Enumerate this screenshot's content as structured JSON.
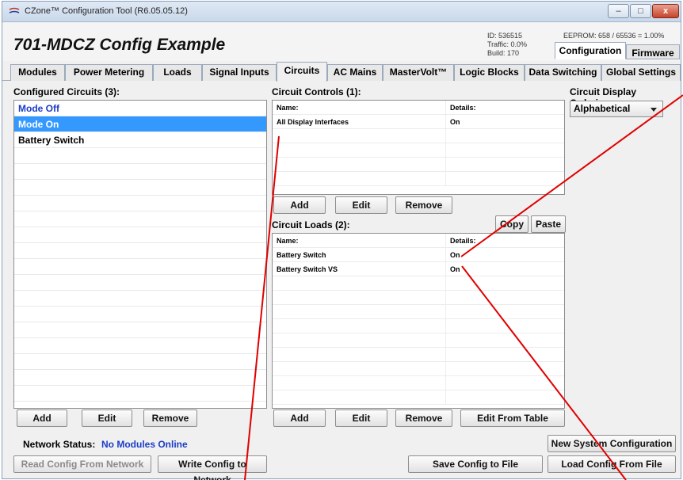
{
  "window": {
    "title": "CZone™ Configuration Tool (R6.05.05.12)",
    "icon": "czone-logo-icon",
    "controls": {
      "minimize": "–",
      "maximize": "□",
      "close": "x"
    }
  },
  "header": {
    "config_name": "701-MDCZ Config Example",
    "id": "ID: 536515",
    "traffic": "Traffic: 0.0%",
    "build": "Build: 170",
    "eeprom": "EEPROM: 658 / 65536 = 1.00%",
    "top_tabs": [
      "Configuration",
      "Firmware"
    ],
    "active_top_tab": "Configuration"
  },
  "tabs": [
    "Modules",
    "Power Metering",
    "Loads",
    "Signal Inputs",
    "Circuits",
    "AC Mains",
    "MasterVolt™",
    "Logic Blocks",
    "Data Switching",
    "Global Settings"
  ],
  "active_tab": "Circuits",
  "configured_circuits": {
    "label": "Configured Circuits (3):",
    "items": [
      "Mode Off",
      "Mode On",
      "Battery Switch"
    ],
    "selected": "Mode On",
    "buttons": {
      "add": "Add",
      "edit": "Edit",
      "remove": "Remove"
    }
  },
  "circuit_controls": {
    "label": "Circuit Controls (1):",
    "headers": {
      "name": "Name:",
      "details": "Details:"
    },
    "rows": [
      {
        "name": "All Display Interfaces",
        "details": "On"
      }
    ],
    "buttons": {
      "add": "Add",
      "edit": "Edit",
      "remove": "Remove"
    }
  },
  "circuit_loads": {
    "label": "Circuit Loads (2):",
    "headers": {
      "name": "Name:",
      "details": "Details:"
    },
    "rows": [
      {
        "name": "Battery Switch",
        "details": "On"
      },
      {
        "name": "Battery Switch VS",
        "details": "On"
      }
    ],
    "copy": "Copy",
    "paste": "Paste",
    "buttons": {
      "add": "Add",
      "edit": "Edit",
      "remove": "Remove",
      "edit_from_table": "Edit From Table"
    }
  },
  "ordering": {
    "label": "Circuit Display Ordering:",
    "value": "Alphabetical"
  },
  "network": {
    "label": "Network Status:",
    "value": "No Modules Online"
  },
  "footer": {
    "new_system": "New System Configuration",
    "read_config": "Read Config From Network",
    "write_config": "Write Config to Network",
    "save_config": "Save Config to File",
    "load_config": "Load Config From File"
  },
  "colors": {
    "accent_blue": "#1a3cc8",
    "selection": "#3399ff",
    "annotation_red": "#e00000"
  }
}
